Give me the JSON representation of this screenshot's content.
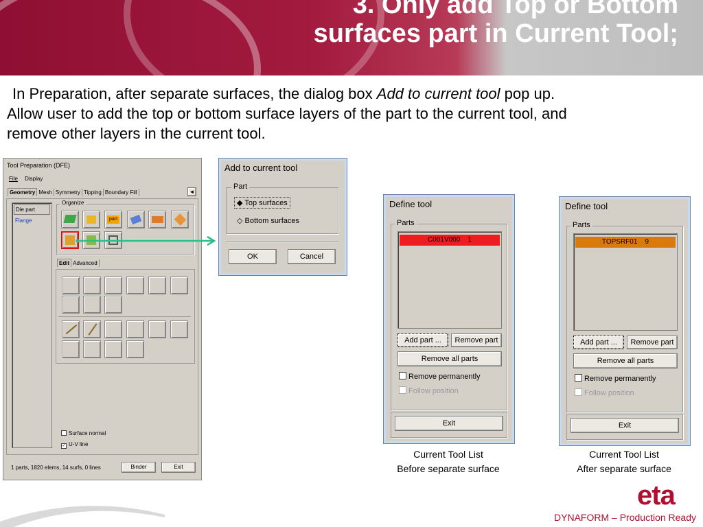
{
  "slide": {
    "title": "3. Only add Top or Bottom surfaces part in Current Tool;",
    "intro_part1": "In Preparation, after separate surfaces, the dialog box ",
    "intro_italic": "Add to current tool",
    "intro_part2": " pop up.",
    "intro_line2": "Allow user to add the top or bottom surface layers of the part to the current tool, and",
    "intro_line3": "remove other layers in the current tool.",
    "footer": "DYNAFORM – Production Ready",
    "logo": "eta"
  },
  "tool_prep": {
    "title": "Tool Preparation (DFE)",
    "menu": [
      "File",
      "Display"
    ],
    "tabs": [
      "Geometry",
      "Mesh",
      "Symmetry",
      "Tipping",
      "Boundary Fill"
    ],
    "parts": [
      "Die part",
      "Flange"
    ],
    "organize_label": "Organize",
    "edit_tabs": [
      "Edit",
      "Advanced"
    ],
    "surface_normal": "Surface normal",
    "uv_line": "U-V line",
    "status": "1 parts, 1820 elems, 14 surfs, 0 lines",
    "binder_button": "Binder",
    "exit_button": "Exit",
    "part_icon_text": "part"
  },
  "add_tool": {
    "title": "Add to current tool",
    "group": "Part",
    "options": [
      "Top surfaces",
      "Bottom surfaces"
    ],
    "selected": "Top surfaces",
    "ok": "OK",
    "cancel": "Cancel"
  },
  "define_before": {
    "title": "Define tool",
    "group": "Parts",
    "part": "C001V000    1",
    "part_color": "#ee1c1c",
    "add_part": "Add part ...",
    "remove_part": "Remove part",
    "remove_all": "Remove all parts",
    "remove_perm": "Remove permanently",
    "follow": "Follow position",
    "exit": "Exit",
    "caption_line1": "Current Tool List",
    "caption_line2": "Before separate surface"
  },
  "define_after": {
    "title": "Define tool",
    "group": "Parts",
    "part": "TOPSRF01    9",
    "part_color": "#d97a0f",
    "add_part": "Add part ...",
    "remove_part": "Remove part",
    "remove_all": "Remove all parts",
    "remove_perm": "Remove permanently",
    "follow": "Follow position",
    "exit": "Exit",
    "caption_line1": "Current Tool List",
    "caption_line2": "After separate surface"
  },
  "colors": {
    "banner": "#a31b3f",
    "arrow": "#2bbd8a",
    "footer_red": "#b0102f"
  }
}
